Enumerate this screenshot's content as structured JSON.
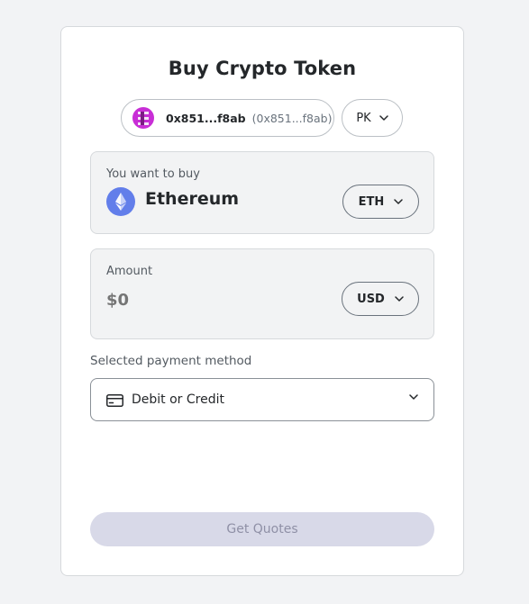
{
  "title": "Buy Crypto Token",
  "account": {
    "name": "0x851...f8ab",
    "address": "(0x851...f8ab)",
    "avatar_icon": "account-avatar-icon"
  },
  "region": {
    "value": "PK"
  },
  "buy": {
    "label": "You want to buy",
    "token_name": "Ethereum",
    "token_symbol": "ETH",
    "token_icon": "ethereum-icon"
  },
  "amount": {
    "label": "Amount",
    "placeholder": "$0",
    "currency": "USD"
  },
  "payment": {
    "label": "Selected payment method",
    "method": "Debit or Credit",
    "method_icon": "credit-card-icon"
  },
  "actions": {
    "get_quotes_label": "Get Quotes",
    "get_quotes_disabled": true
  },
  "colors": {
    "page_bg": "#f2f3f5",
    "card_bg": "#ffffff",
    "box_bg": "#f2f3f4",
    "ethereum_blue": "#627eea",
    "avatar_magenta": "#c82ed6",
    "disabled_button_bg": "#d8d9e8",
    "disabled_button_text": "#8f90a6"
  }
}
